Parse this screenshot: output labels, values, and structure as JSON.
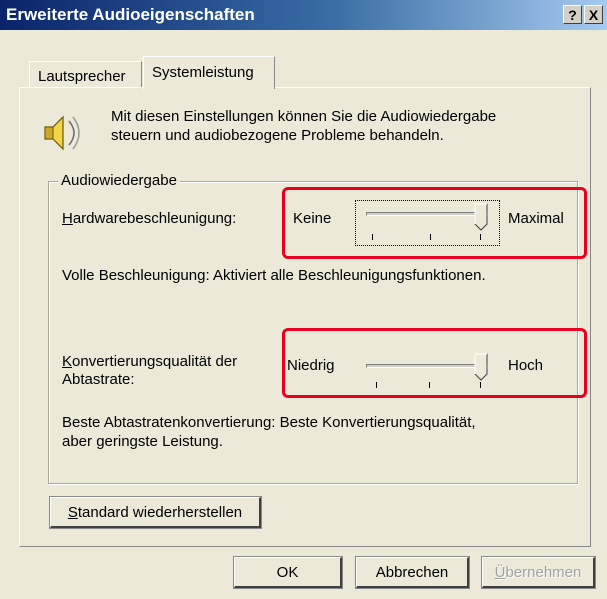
{
  "window": {
    "title": "Erweiterte Audioeigenschaften",
    "help_label": "?",
    "close_label": "X"
  },
  "tabs": [
    {
      "label": "Lautsprecher",
      "selected": false
    },
    {
      "label": "Systemleistung",
      "selected": true
    }
  ],
  "intro": {
    "icon": "speaker-icon",
    "line1": "Mit diesen Einstellungen können Sie die Audiowiedergabe",
    "line2": "steuern und audiobezogene Probleme behandeln."
  },
  "group": {
    "title": "Audiowiedergabe",
    "hardware": {
      "label_mnemonic": "H",
      "label_rest": "ardwarebeschleunigung:",
      "min_label": "Keine",
      "max_label": "Maximal",
      "level": 1.0,
      "description": "Volle Beschleunigung: Aktiviert alle Beschleunigungsfunktionen."
    },
    "conversion": {
      "label_mnemonic": "K",
      "label_rest": "onvertierungsqualität der",
      "label_line2": "Abtastrate:",
      "min_label": "Niedrig",
      "max_label": "Hoch",
      "level": 1.0,
      "description_line1": "Beste Abtastratenkonvertierung: Beste Konvertierungsqualität,",
      "description_line2": "aber geringste Leistung."
    }
  },
  "restore_button": {
    "mnemonic": "S",
    "rest": "tandard wiederherstellen"
  },
  "footer": {
    "ok_label": "OK",
    "cancel_label": "Abbrechen",
    "apply_mnemonic": "Ü",
    "apply_rest": "bernehmen",
    "apply_enabled": false
  },
  "highlight_color": "#e8001e"
}
